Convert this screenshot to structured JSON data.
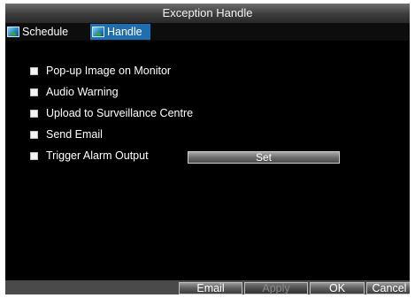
{
  "window": {
    "title": "Exception Handle"
  },
  "tabs": [
    {
      "label": "Schedule",
      "icon": "picture-icon",
      "active": false
    },
    {
      "label": "Handle",
      "icon": "picture-icon",
      "active": true
    }
  ],
  "options": [
    {
      "label": "Pop-up Image on Monitor",
      "checked": false
    },
    {
      "label": "Audio Warning",
      "checked": false
    },
    {
      "label": "Upload to Surveillance Centre",
      "checked": false
    },
    {
      "label": "Send Email",
      "checked": false
    },
    {
      "label": "Trigger Alarm Output",
      "checked": false
    }
  ],
  "set_button": {
    "label": "Set"
  },
  "footer": {
    "email_label": "Email",
    "apply_label": "Apply",
    "ok_label": "OK",
    "cancel_label": "Cancel"
  },
  "colors": {
    "background": "#000000",
    "active_tab": "#1f6fb0",
    "text": "#ffffff"
  }
}
